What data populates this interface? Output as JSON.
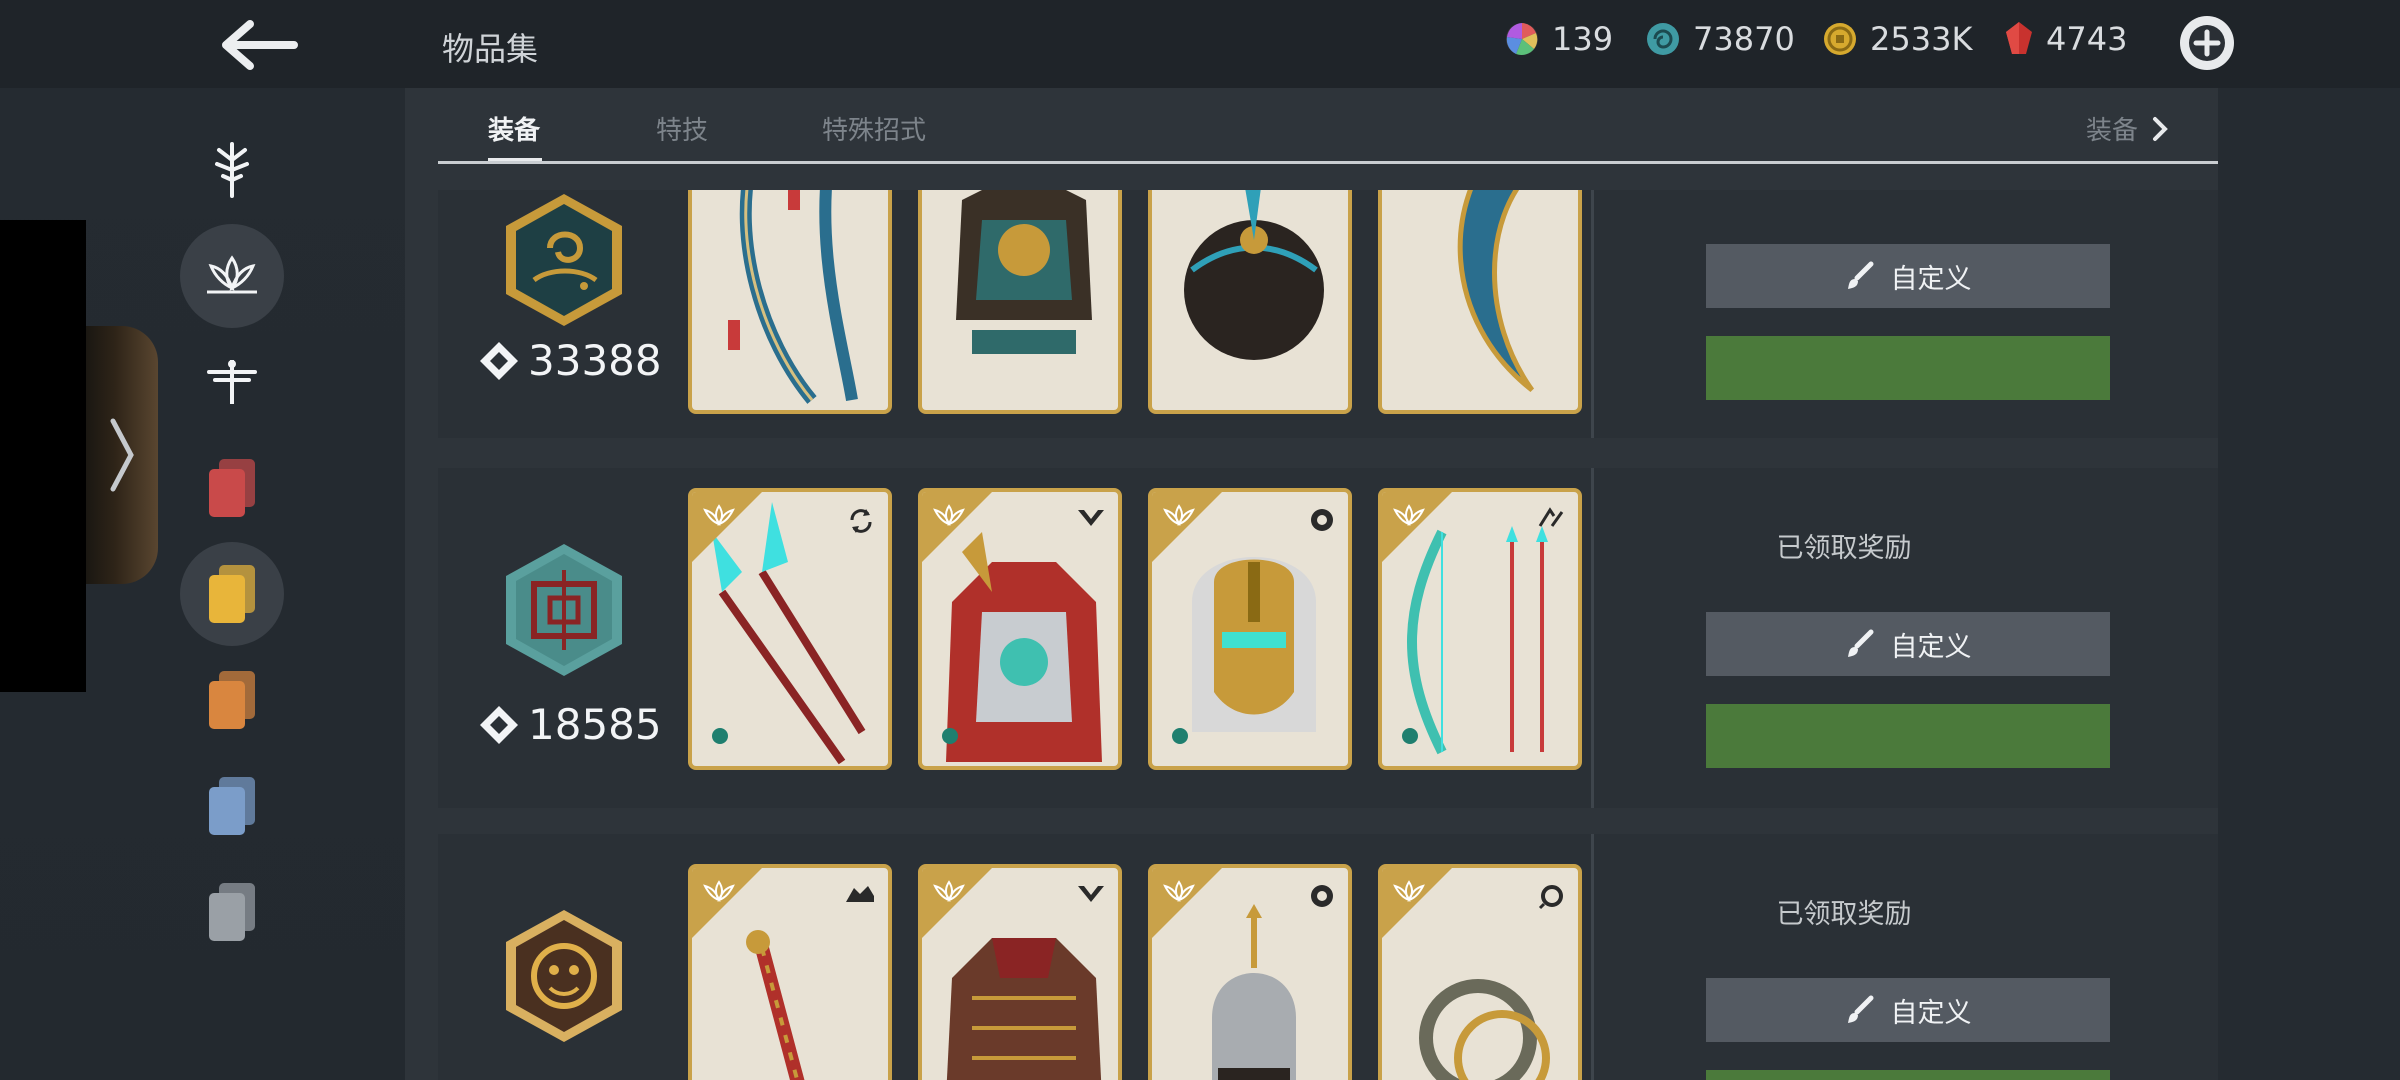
{
  "header": {
    "title": "物品集",
    "currencies": [
      {
        "name": "color-orb-icon",
        "value": "139"
      },
      {
        "name": "spiral-coin-icon",
        "value": "73870"
      },
      {
        "name": "gold-coin-icon",
        "value": "2533K"
      },
      {
        "name": "red-crystal-icon",
        "value": "4743"
      }
    ]
  },
  "tabs": {
    "items": [
      "装备",
      "特技",
      "特殊招式"
    ],
    "active": "装备",
    "right_label": "装备"
  },
  "sidebar": {
    "icons": [
      "warrior-icon",
      "lotus-icon",
      "dragonfly-icon",
      "red-cards-icon",
      "yellow-cards-icon",
      "orange-cards-icon",
      "blue-cards-icon",
      "gray-cards-icon"
    ],
    "active_index": 1,
    "colors": {
      "red": "#c94a4a",
      "yellow": "#e8b53a",
      "orange": "#d9863f",
      "blue": "#7b9dc9",
      "gray": "#9aa0a6"
    }
  },
  "rows": [
    {
      "score": "33388",
      "status": "",
      "custom_label": "自定义",
      "emblem_color": "#1e3f44",
      "emblem_accent": "#c79a3a"
    },
    {
      "score": "18585",
      "status": "已领取奖励",
      "custom_label": "自定义",
      "emblem_color": "#4a8c8a",
      "emblem_accent": "#8a2424"
    },
    {
      "score": "",
      "status": "已领取奖励",
      "custom_label": "自定义",
      "emblem_color": "#4a3020",
      "emblem_accent": "#e0b04a"
    }
  ],
  "colors": {
    "accent_gold": "#c9a24a",
    "button_green": "#4b7a3b",
    "button_gray": "#545a62"
  }
}
